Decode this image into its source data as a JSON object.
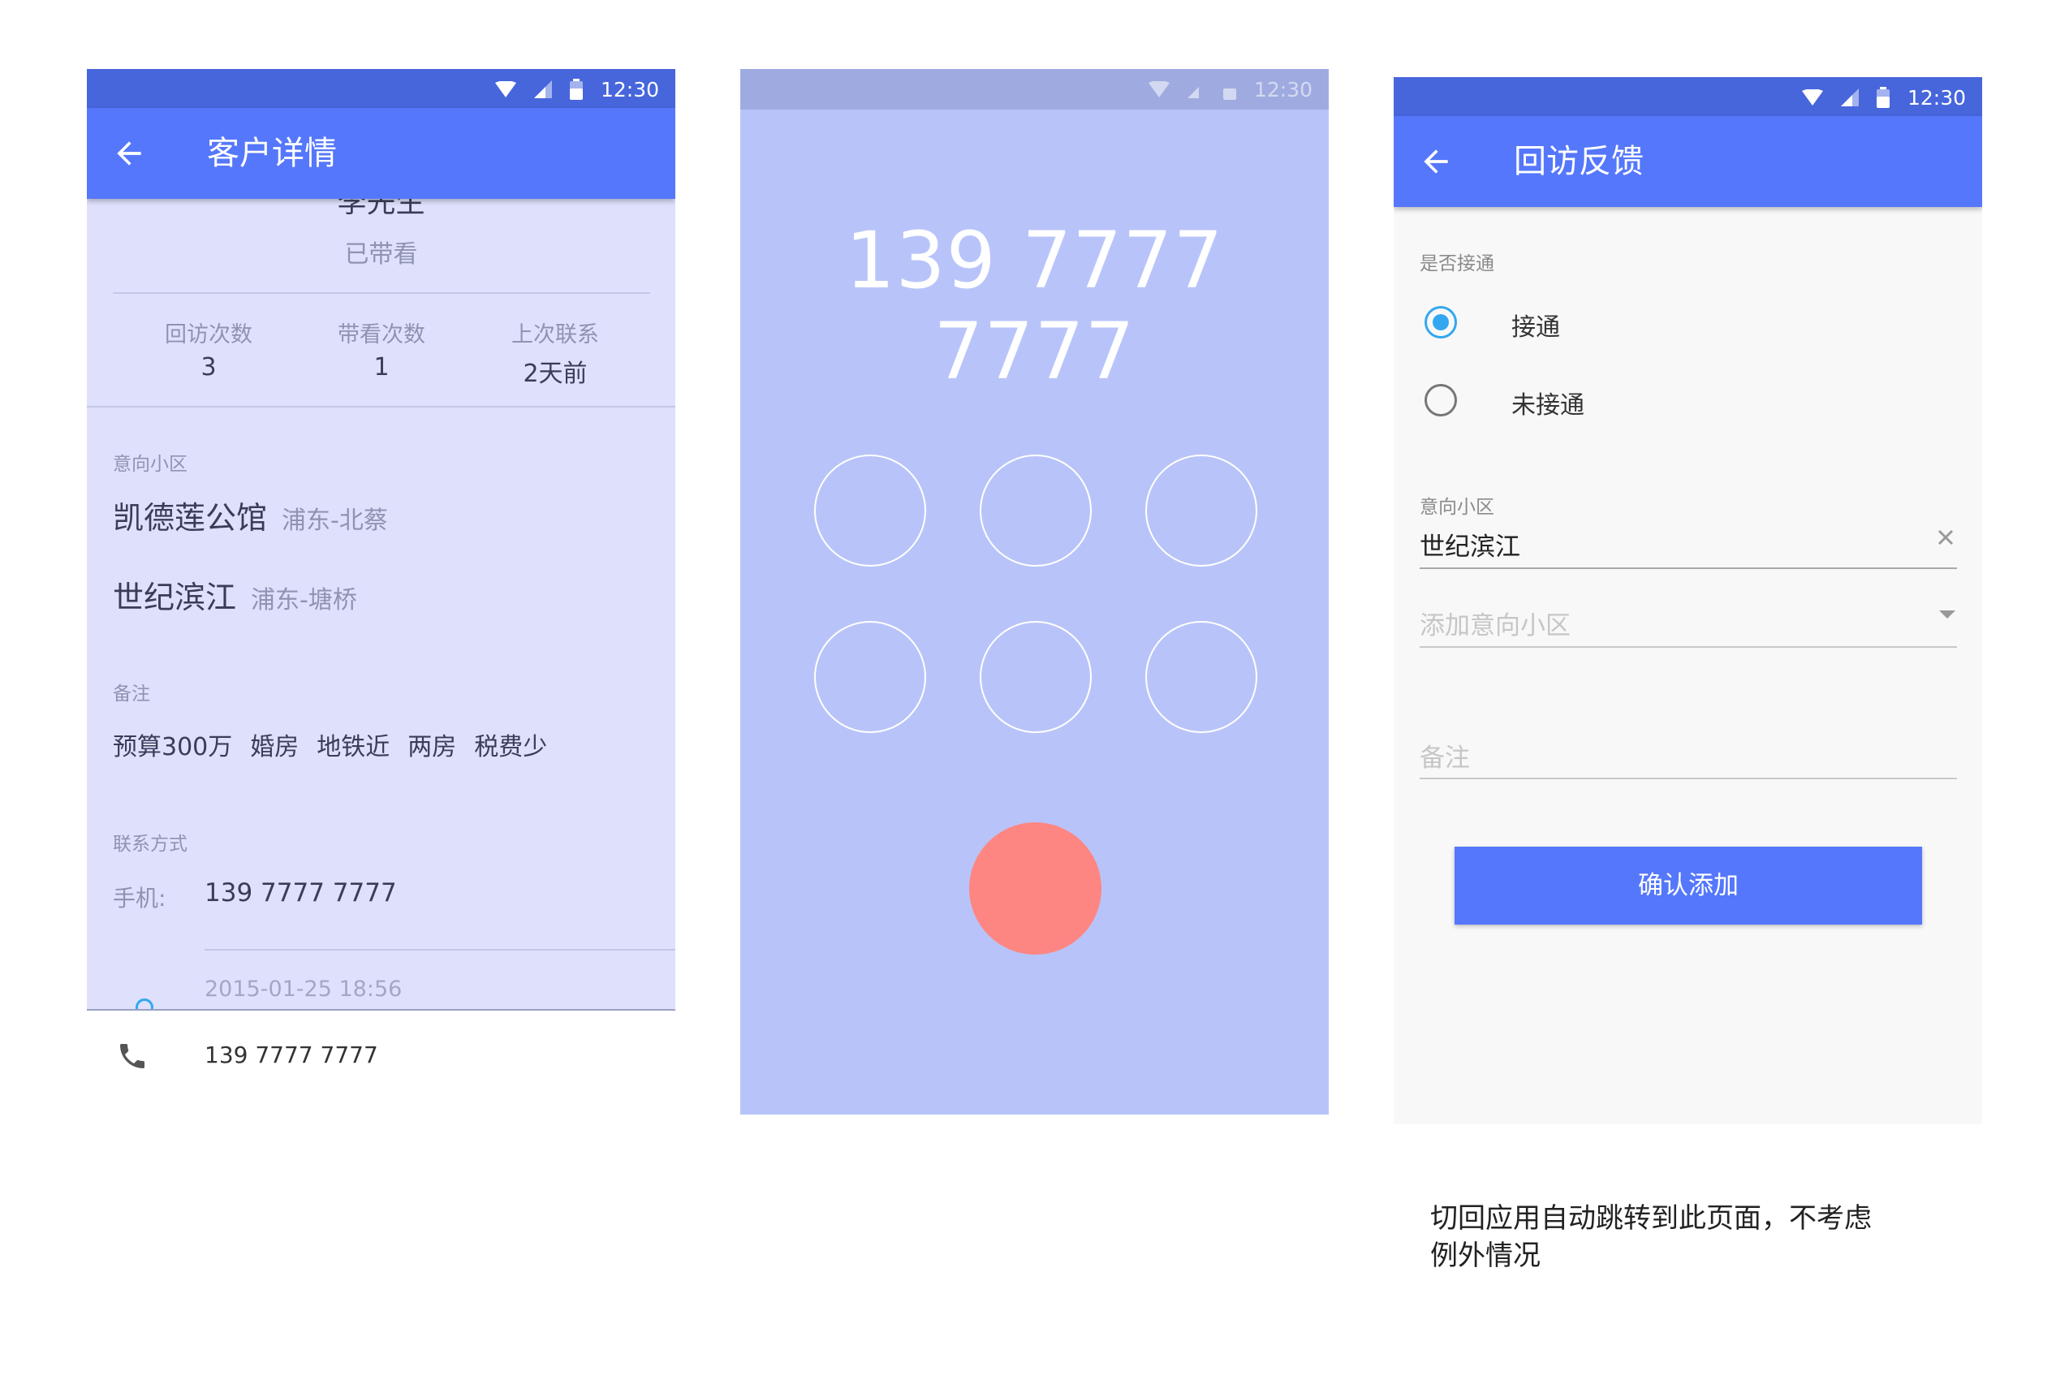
{
  "status": {
    "time": "12:30"
  },
  "screen1": {
    "title": "客户详情",
    "customer_name": "李先生",
    "customer_status": "已带看",
    "stats": [
      {
        "label": "回访次数",
        "value": "3"
      },
      {
        "label": "带看次数",
        "value": "1"
      },
      {
        "label": "上次联系",
        "value": "2天前"
      }
    ],
    "areas_label": "意向小区",
    "areas": [
      {
        "name": "凯德莲公馆",
        "region": "浦东-北蔡"
      },
      {
        "name": "世纪滨江",
        "region": "浦东-塘桥"
      }
    ],
    "notes_label": "备注",
    "tags": [
      "预算300万",
      "婚房",
      "地铁近",
      "两房",
      "税费少"
    ],
    "contact_label": "联系方式",
    "phone_label": "手机:",
    "phone": "139 7777 7777",
    "last_call_time": "2015-01-25  18:56",
    "sheet_phone": "139 7777 7777"
  },
  "screen2": {
    "number": "139 7777 7777"
  },
  "screen3": {
    "title": "回访反馈",
    "connected_label": "是否接通",
    "options": [
      {
        "label": "接通",
        "selected": true
      },
      {
        "label": "未接通",
        "selected": false
      }
    ],
    "area_label": "意向小区",
    "area_value": "世纪滨江",
    "add_area_placeholder": "添加意向小区",
    "notes_placeholder": "备注",
    "confirm_label": "确认添加"
  },
  "note": "切回应用自动跳转到此页面，不考虑例外情况",
  "colors": {
    "primary": "#5577fb",
    "statusbar": "#4766dc",
    "radio_accent": "#33a8f0",
    "hangup": "#fe8682",
    "dialer_bg": "#b8c4f9"
  }
}
